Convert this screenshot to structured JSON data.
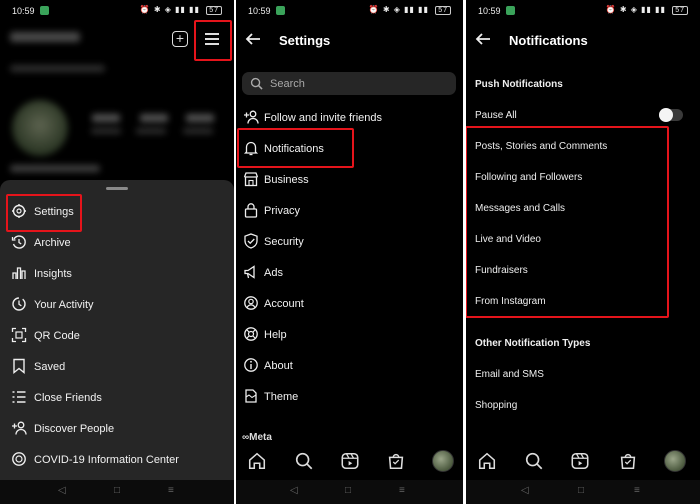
{
  "colors": {
    "background": "#000000",
    "sheet": "#262626",
    "highlight": "#e5141b",
    "text": "#f1f1f1",
    "muted": "#a8a8a8"
  },
  "statusbar": {
    "time": "10:59",
    "battery": "57"
  },
  "panel1": {
    "sheet_items": [
      {
        "label": "Settings",
        "icon": "settings-gear-icon"
      },
      {
        "label": "Archive",
        "icon": "archive-clock-icon"
      },
      {
        "label": "Insights",
        "icon": "bar-chart-icon"
      },
      {
        "label": "Your Activity",
        "icon": "activity-clock-icon"
      },
      {
        "label": "QR Code",
        "icon": "qr-code-icon"
      },
      {
        "label": "Saved",
        "icon": "bookmark-icon"
      },
      {
        "label": "Close Friends",
        "icon": "list-icon"
      },
      {
        "label": "Discover People",
        "icon": "add-person-icon"
      },
      {
        "label": "COVID-19 Information Center",
        "icon": "info-shield-icon"
      }
    ]
  },
  "panel2": {
    "title": "Settings",
    "search_placeholder": "Search",
    "items": [
      {
        "label": "Follow and invite friends",
        "icon": "add-person-icon"
      },
      {
        "label": "Notifications",
        "icon": "bell-icon"
      },
      {
        "label": "Business",
        "icon": "store-icon"
      },
      {
        "label": "Privacy",
        "icon": "lock-icon"
      },
      {
        "label": "Security",
        "icon": "shield-check-icon"
      },
      {
        "label": "Ads",
        "icon": "megaphone-icon"
      },
      {
        "label": "Account",
        "icon": "account-icon"
      },
      {
        "label": "Help",
        "icon": "help-icon"
      },
      {
        "label": "About",
        "icon": "info-icon"
      },
      {
        "label": "Theme",
        "icon": "theme-icon"
      }
    ],
    "footer_logo": "∞Meta"
  },
  "panel3": {
    "title": "Notifications",
    "push_heading": "Push Notifications",
    "pause_all": "Pause All",
    "pause_all_on": false,
    "push_items": [
      "Posts, Stories and Comments",
      "Following and Followers",
      "Messages and Calls",
      "Live and Video",
      "Fundraisers",
      "From Instagram"
    ],
    "other_heading": "Other Notification Types",
    "other_items": [
      "Email and SMS",
      "Shopping"
    ]
  },
  "bottom_nav": [
    "home-icon",
    "search-icon",
    "reels-icon",
    "shop-icon",
    "profile-avatar"
  ],
  "system_nav": [
    "back-triangle-icon",
    "home-square-icon",
    "recents-menu-icon"
  ]
}
